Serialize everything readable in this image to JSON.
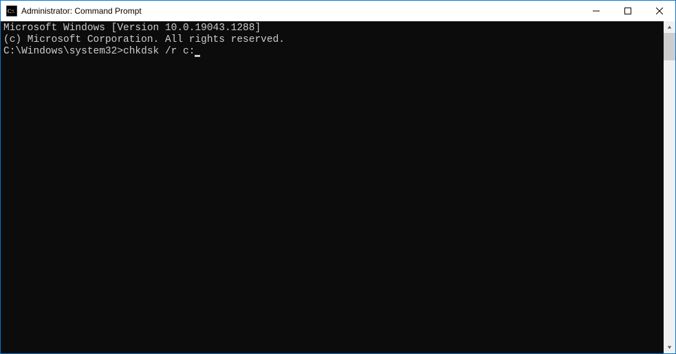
{
  "window": {
    "title": "Administrator: Command Prompt"
  },
  "terminal": {
    "line1": "Microsoft Windows [Version 10.0.19043.1288]",
    "line2": "(c) Microsoft Corporation. All rights reserved.",
    "blank": "",
    "prompt": "C:\\Windows\\system32>",
    "command": "chkdsk /r c:"
  }
}
